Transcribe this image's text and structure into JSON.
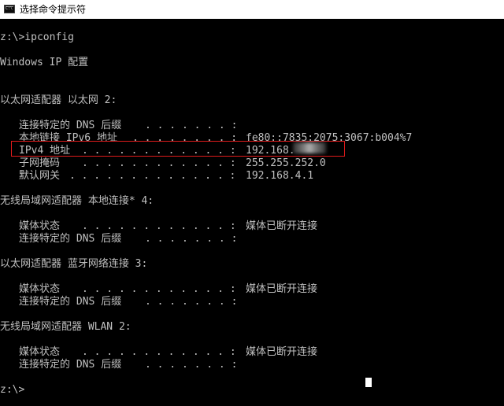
{
  "window": {
    "title": "选择命令提示符"
  },
  "console": {
    "prompt1": "z:\\>ipconfig",
    "header": "Windows IP 配置",
    "adapter1": {
      "title": "以太网适配器 以太网 2:",
      "rows": [
        {
          "label": "连接特定的 DNS 后缀",
          "dots": ". . . . . . . :",
          "value": ""
        },
        {
          "label": "本地链接 IPv6 地址",
          "dots": ". . . . . . . . :",
          "value": "fe80::7835:2075:3067:b004%7"
        },
        {
          "label": "IPv4 地址",
          "dots": ". . . . . . . . . . . . :",
          "value": "192.168."
        },
        {
          "label": "子网掩码",
          "dots": ". . . . . . . . . . . . :",
          "value": "255.255.252.0"
        },
        {
          "label": "默认网关",
          "dots": ". . . . . . . . . . . . . :",
          "value": "192.168.4.1"
        }
      ]
    },
    "adapter2": {
      "title": "无线局域网适配器 本地连接* 4:",
      "rows": [
        {
          "label": "媒体状态",
          "dots": ". . . . . . . . . . . . :",
          "value": "媒体已断开连接"
        },
        {
          "label": "连接特定的 DNS 后缀",
          "dots": ". . . . . . . :",
          "value": ""
        }
      ]
    },
    "adapter3": {
      "title": "以太网适配器 蓝牙网络连接 3:",
      "rows": [
        {
          "label": "媒体状态",
          "dots": ". . . . . . . . . . . . :",
          "value": "媒体已断开连接"
        },
        {
          "label": "连接特定的 DNS 后缀",
          "dots": ". . . . . . . :",
          "value": ""
        }
      ]
    },
    "adapter4": {
      "title": "无线局域网适配器 WLAN 2:",
      "rows": [
        {
          "label": "媒体状态",
          "dots": ". . . . . . . . . . . . :",
          "value": "媒体已断开连接"
        },
        {
          "label": "连接特定的 DNS 后缀",
          "dots": ". . . . . . . :",
          "value": ""
        }
      ]
    },
    "prompt2": "z:\\>"
  },
  "colors": {
    "background": "#000000",
    "text": "#c0c0c0",
    "highlight_border": "#e01b1b"
  }
}
